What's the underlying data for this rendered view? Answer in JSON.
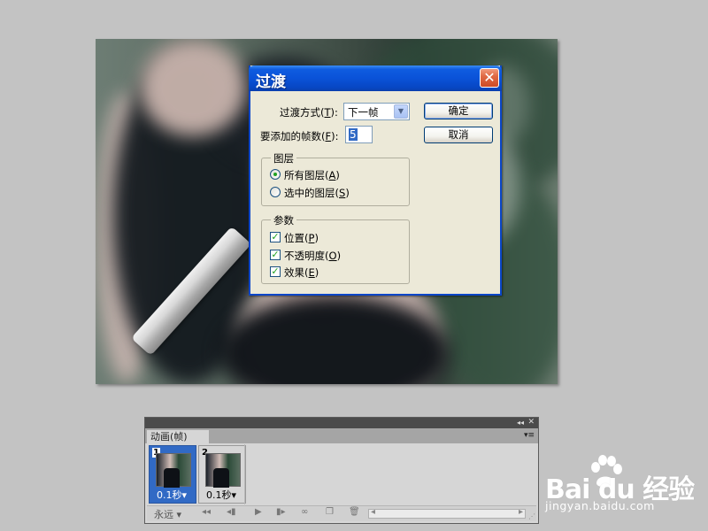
{
  "dialog": {
    "title": "过渡",
    "close_glyph": "✕",
    "method_label": "过渡方式(",
    "method_key": "T",
    "method_suffix": "):",
    "method_value": "下一帧",
    "frames_label": "要添加的帧数(",
    "frames_key": "F",
    "frames_suffix": "):",
    "frames_value": "5",
    "ok_label": "确定",
    "cancel_label": "取消",
    "layers_group": {
      "title": "图层",
      "options": [
        {
          "label": "所有图层(",
          "key": "A",
          "suffix": ")",
          "selected": true
        },
        {
          "label": "选中的图层(",
          "key": "S",
          "suffix": ")",
          "selected": false
        }
      ]
    },
    "params_group": {
      "title": "参数",
      "options": [
        {
          "label": "位置(",
          "key": "P",
          "suffix": ")",
          "checked": true
        },
        {
          "label": "不透明度(",
          "key": "O",
          "suffix": ")",
          "checked": true
        },
        {
          "label": "效果(",
          "key": "E",
          "suffix": ")",
          "checked": true
        }
      ]
    }
  },
  "animation_panel": {
    "tab_label": "动画(帧)",
    "collapse_glyph": "◂◂",
    "close_glyph": "✕",
    "menu_glyph": "▾≡",
    "frames": [
      {
        "number": "1",
        "time": "0.1秒▾",
        "selected": true
      },
      {
        "number": "2",
        "time": "0.1秒▾",
        "selected": false
      }
    ],
    "loop_label": "永远 ▾",
    "controls": [
      "◂◂",
      "◂▮",
      "▶",
      "▮▸",
      "∞",
      "❐",
      "🗑"
    ]
  },
  "watermark": {
    "brand": "Bai du 经验",
    "url": "jingyan.baidu.com"
  },
  "colors": {
    "background": "#c3c3c3",
    "titlebar_blue": "#0a52d8",
    "dialog_face": "#ece9d8",
    "close_red": "#e06a45",
    "selected_frame": "#316ac5"
  }
}
